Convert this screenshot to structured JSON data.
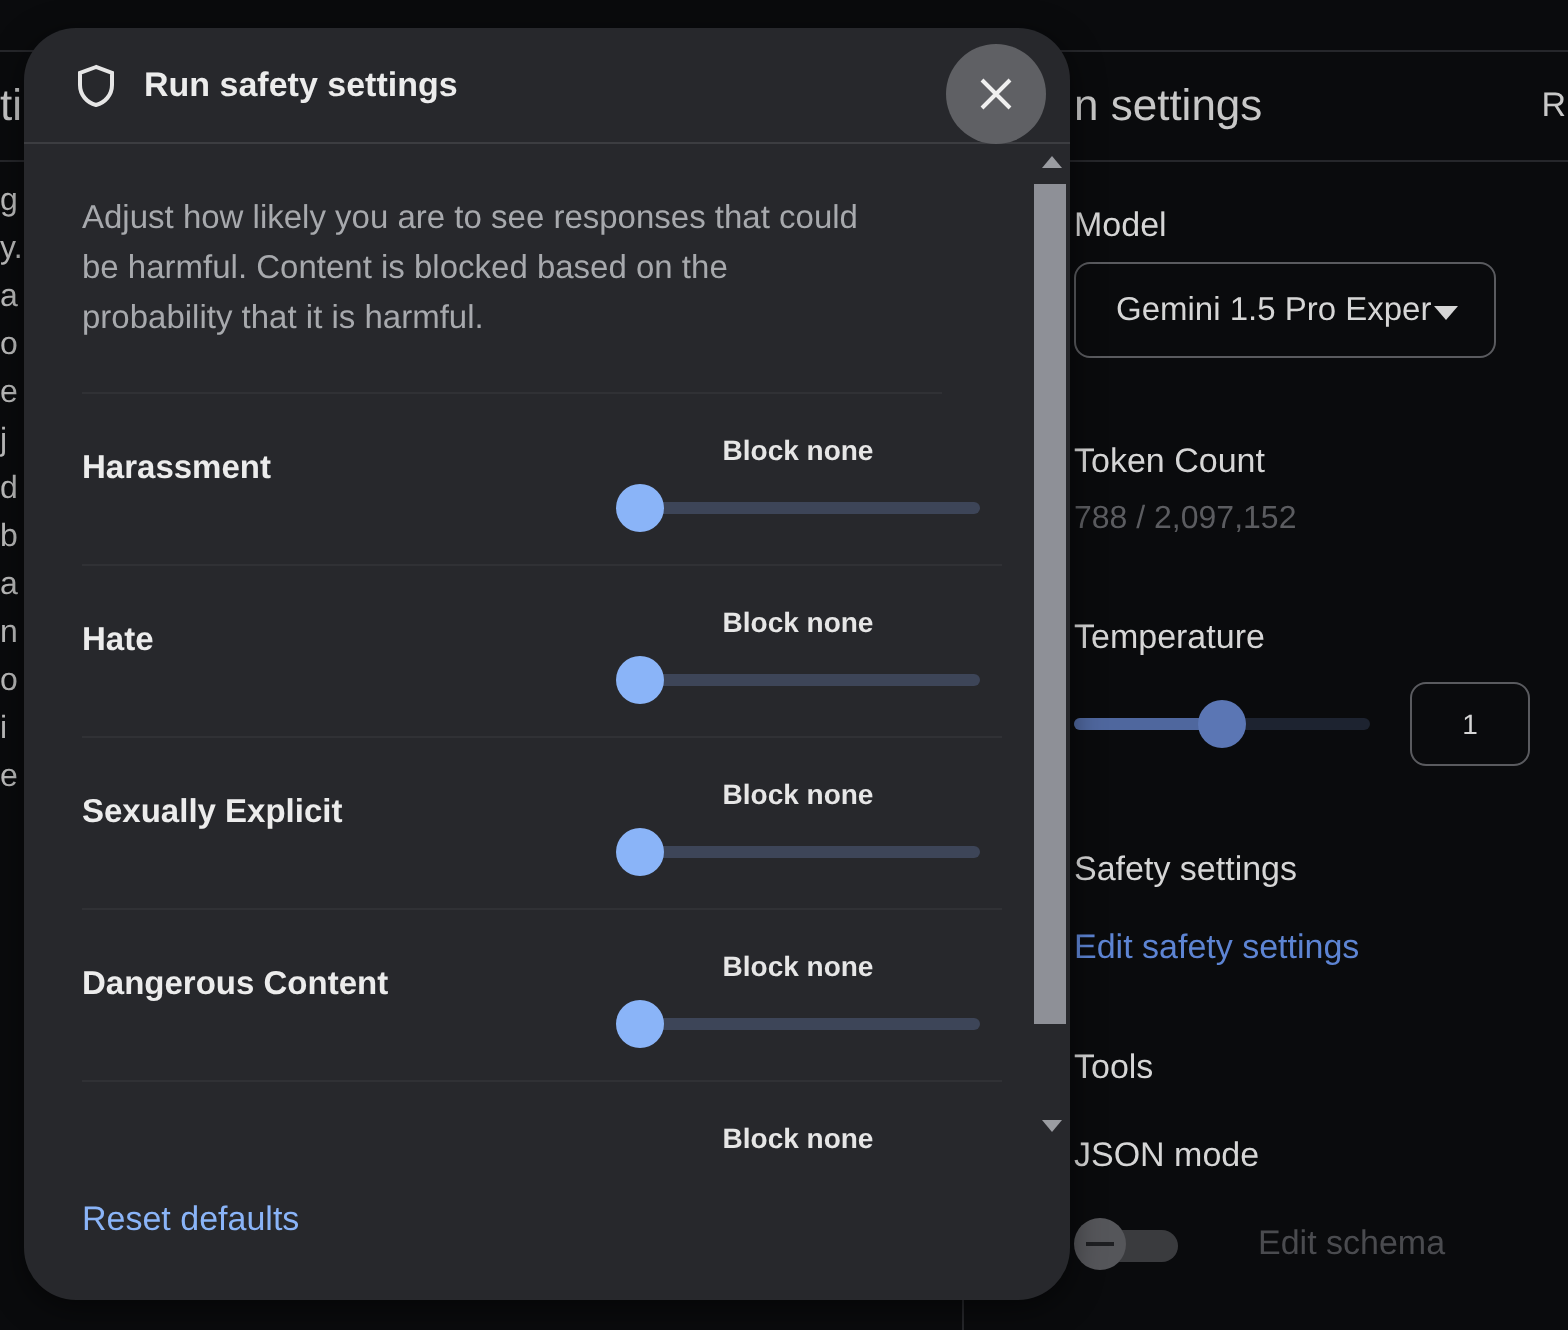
{
  "background_page": {
    "left_fragments": {
      "heading": "ti",
      "lines": [
        "g",
        "y.",
        "a",
        "o",
        "e",
        "j",
        "d",
        "b",
        "a",
        "n",
        "o",
        "i",
        "e"
      ]
    },
    "run_settings": {
      "title": "n settings",
      "header_action": "R",
      "model": {
        "label": "Model",
        "value": "Gemini 1.5 Pro Exper"
      },
      "token_count": {
        "label": "Token Count",
        "value": "788 / 2,097,152"
      },
      "temperature": {
        "label": "Temperature",
        "level": 0.5,
        "value": "1"
      },
      "safety": {
        "label": "Safety settings",
        "link": "Edit safety settings"
      },
      "tools": {
        "label": "Tools"
      },
      "json_mode": {
        "label": "JSON mode",
        "on": false,
        "action": "Edit schema",
        "action_disabled": true
      }
    }
  },
  "dialog": {
    "title": "Run safety settings",
    "description": "Adjust how likely you are to see responses that could be harmful. Content is blocked based on the probability that it is harmful.",
    "categories": [
      {
        "name": "Harassment",
        "setting": "Block none",
        "level": 0
      },
      {
        "name": "Hate",
        "setting": "Block none",
        "level": 0
      },
      {
        "name": "Sexually Explicit",
        "setting": "Block none",
        "level": 0
      },
      {
        "name": "Dangerous Content",
        "setting": "Block none",
        "level": 0
      }
    ],
    "partial_category": {
      "setting": "Block none"
    },
    "footer_link": "Reset defaults"
  }
}
